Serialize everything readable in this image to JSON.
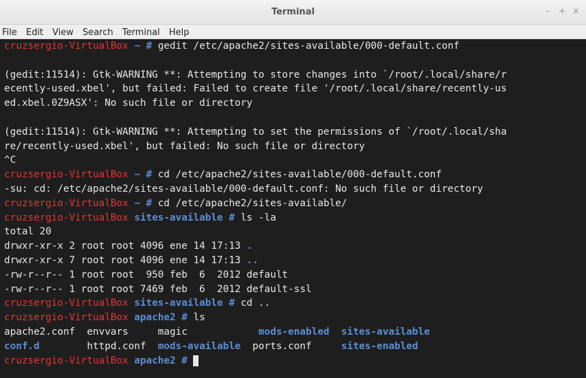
{
  "window": {
    "title": "Terminal",
    "controls": [
      "–",
      "+",
      "×"
    ]
  },
  "menu": [
    "File",
    "Edit",
    "View",
    "Search",
    "Terminal",
    "Help"
  ],
  "prompt": {
    "user_host": "cruzsergio-VirtualBox",
    "hash": "#"
  },
  "colors": {
    "prompt_user": "#e8343a",
    "prompt_path": "#5b8fd6",
    "background": "#1e1e1e",
    "text": "#e8e8e8"
  },
  "lines": [
    {
      "path": "~",
      "cmd": "gedit /etc/apache2/sites-available/000-default.conf"
    },
    {
      "text": ""
    },
    {
      "text": "(gedit:11514): Gtk-WARNING **: Attempting to store changes into `/root/.local/share/r"
    },
    {
      "text": "ecently-used.xbel', but failed: Failed to create file '/root/.local/share/recently-us"
    },
    {
      "text": "ed.xbel.0Z9ASX': No such file or directory"
    },
    {
      "text": ""
    },
    {
      "text": "(gedit:11514): Gtk-WARNING **: Attempting to set the permissions of `/root/.local/sha"
    },
    {
      "text": "re/recently-used.xbel', but failed: No such file or directory"
    },
    {
      "text": "^C"
    },
    {
      "path": "~",
      "cmd": "cd /etc/apache2/sites-available/000-default.conf"
    },
    {
      "text": "-su: cd: /etc/apache2/sites-available/000-default.conf: No such file or directory"
    },
    {
      "path": "~",
      "cmd": "cd /etc/apache2/sites-available/"
    },
    {
      "path": "sites-available",
      "cmd": "ls -la"
    },
    {
      "text": "total 20"
    },
    {
      "text": "drwxr-xr-x 2 root root 4096 ene 14 17:13 ",
      "dir": "."
    },
    {
      "text": "drwxr-xr-x 7 root root 4096 ene 14 17:13 ",
      "dir": ".."
    },
    {
      "text": "-rw-r--r-- 1 root root  950 feb  6  2012 default"
    },
    {
      "text": "-rw-r--r-- 1 root root 7469 feb  6  2012 default-ssl"
    },
    {
      "path": "sites-available",
      "cmd": "cd .."
    },
    {
      "path": "apache2",
      "cmd": "ls"
    },
    {
      "cols": [
        {
          "t": "apache2.conf  envvars     magic            "
        },
        {
          "t": "mods-enabled",
          "d": true
        },
        {
          "t": "  "
        },
        {
          "t": "sites-available",
          "d": true
        }
      ]
    },
    {
      "cols": [
        {
          "t": "conf.d",
          "d": true
        },
        {
          "t": "        httpd.conf  "
        },
        {
          "t": "mods-available",
          "d": true
        },
        {
          "t": "  ports.conf     "
        },
        {
          "t": "sites-enabled",
          "d": true
        }
      ]
    },
    {
      "path": "apache2",
      "cmd": "",
      "cursor": true
    }
  ]
}
